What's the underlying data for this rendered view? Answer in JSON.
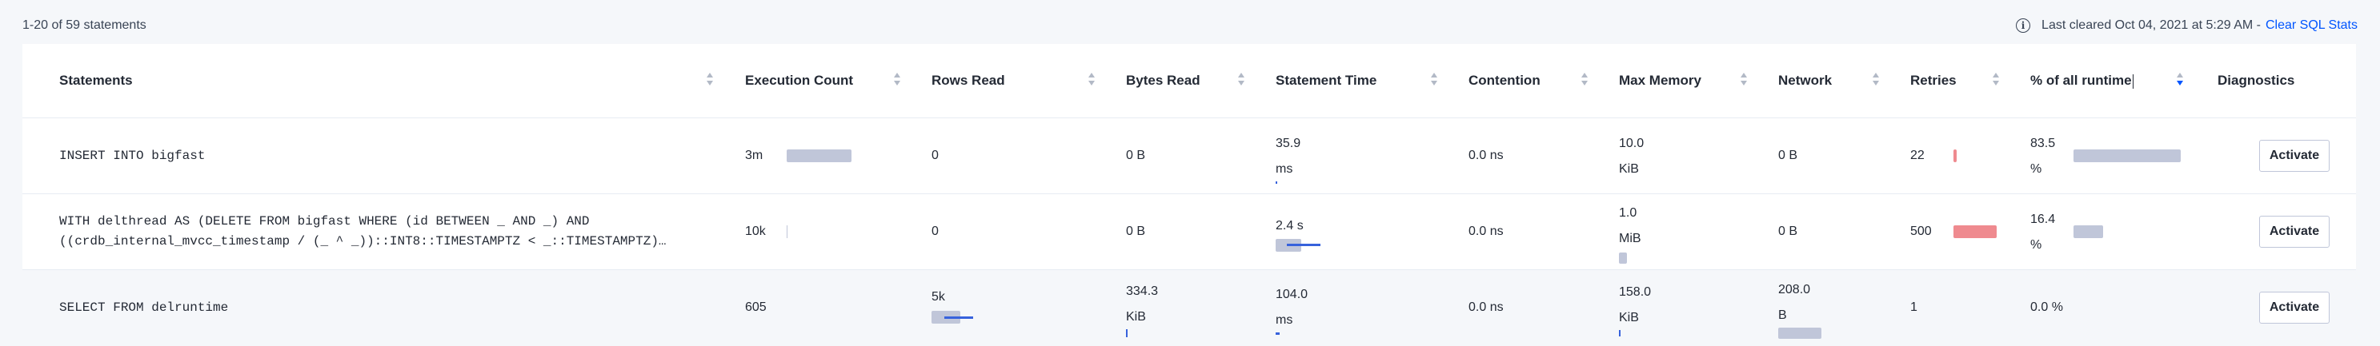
{
  "topbar": {
    "pagination": "1-20 of 59 statements",
    "last_cleared": "Last cleared Oct 04, 2021 at 5:29 AM -",
    "clear_link": "Clear SQL Stats"
  },
  "columns": [
    "Statements",
    "Execution Count",
    "Rows Read",
    "Bytes Read",
    "Statement Time",
    "Contention",
    "Max Memory",
    "Network",
    "Retries",
    "% of all runtime",
    "Diagnostics"
  ],
  "rows": [
    {
      "statement": [
        "INSERT INTO bigfast"
      ],
      "execution_count": "3m",
      "rows_read": "0",
      "bytes_read": "0 B",
      "statement_time": [
        "35.9",
        "ms"
      ],
      "contention": "0.0 ns",
      "max_memory": [
        "10.0",
        "KiB"
      ],
      "network": "0 B",
      "retries": "22",
      "pct_runtime": [
        "83.5",
        "%"
      ],
      "action": "Activate"
    },
    {
      "statement": [
        "WITH delthread AS (DELETE FROM bigfast WHERE (id BETWEEN _ AND _) AND",
        "((crdb_internal_mvcc_timestamp / (_ ^ _))::INT8::TIMESTAMPTZ < _::TIMESTAMPTZ)…"
      ],
      "execution_count": "10k",
      "rows_read": "0",
      "bytes_read": "0 B",
      "statement_time": [
        "2.4 s"
      ],
      "contention": "0.0 ns",
      "max_memory": [
        "1.0",
        "MiB"
      ],
      "network": "0 B",
      "retries": "500",
      "pct_runtime": [
        "16.4",
        "%"
      ],
      "action": "Activate"
    },
    {
      "statement": [
        "SELECT FROM delruntime"
      ],
      "execution_count": "605",
      "rows_read": "5k",
      "bytes_read": [
        "334.3",
        "KiB"
      ],
      "statement_time": [
        "104.0",
        "ms"
      ],
      "contention": "0.0 ns",
      "max_memory": [
        "158.0",
        "KiB"
      ],
      "network": [
        "208.0",
        "B"
      ],
      "retries": "1",
      "pct_runtime": [
        "0.0 %"
      ],
      "action": "Activate"
    }
  ],
  "bars": {
    "execution_count": [
      0.85,
      0.02,
      0
    ],
    "retries": [
      0.1,
      1.0,
      0
    ],
    "pct_runtime": [
      0.835,
      0.164,
      0
    ],
    "statement_time": [
      0.01,
      1.0,
      0.02
    ],
    "max_memory": [
      0,
      0.01,
      0
    ],
    "rows_read": [
      0,
      0,
      1.0
    ],
    "bytes_read": [
      0,
      0,
      0.01
    ],
    "network": [
      0,
      0,
      1.0
    ]
  },
  "colors": {
    "accent": "#0055ff",
    "bar": "#c0c6d9",
    "bar_red": "#ef8a8f",
    "deviation": "#3762dc"
  }
}
